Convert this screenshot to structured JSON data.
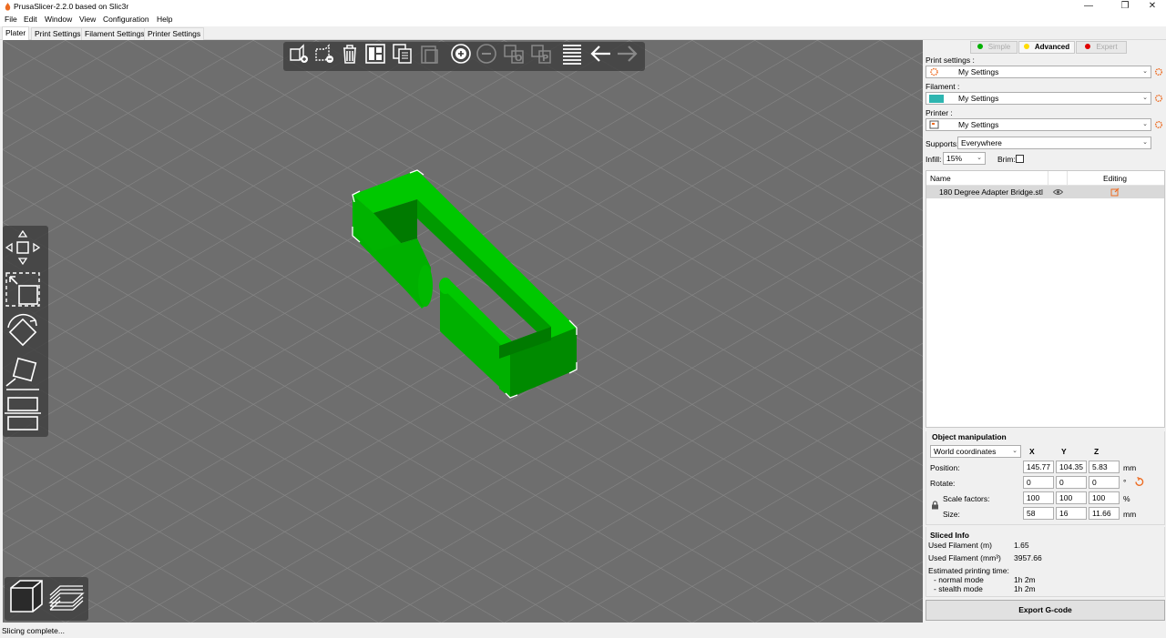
{
  "window": {
    "title": "PrusaSlicer-2.2.0 based on Slic3r",
    "minimize": "—",
    "restore": "❐",
    "close": "✕"
  },
  "menu": [
    "File",
    "Edit",
    "Window",
    "View",
    "Configuration",
    "Help"
  ],
  "tabs": [
    "Plater",
    "Print Settings",
    "Filament Settings",
    "Printer Settings"
  ],
  "top_toolbar_icons": [
    "add-icon",
    "delete-all-icon",
    "delete-icon",
    "arrange-icon",
    "copy-icon",
    "paste-icon",
    "add-instance-icon",
    "remove-instance-icon",
    "split-objects-icon",
    "split-parts-icon",
    "layers-editing-icon",
    "undo-icon",
    "redo-icon"
  ],
  "left_toolbar_icons": [
    "move-icon",
    "scale-icon",
    "rotate-icon",
    "place-on-face-icon",
    "cut-icon"
  ],
  "bottom_toolbar_icons": [
    "3d-view-icon",
    "preview-icon"
  ],
  "status": "Slicing complete...",
  "sidebar": {
    "modes": {
      "simple": "Simple",
      "advanced": "Advanced",
      "expert": "Expert"
    },
    "mode_colors": {
      "simple": "#00b000",
      "advanced": "#ffdc00",
      "expert": "#e00000"
    },
    "print_settings_label": "Print settings :",
    "print_settings_value": "My Settings",
    "filament_label": "Filament :",
    "filament_value": "My Settings",
    "filament_color": "#2eb5b0",
    "printer_label": "Printer :",
    "printer_value": "My Settings",
    "supports_label": "Supports:",
    "supports_value": "Everywhere",
    "infill_label": "Infill:",
    "infill_value": "15%",
    "brim_label": "Brim:",
    "brim_checked": false,
    "object_list": {
      "col_name": "Name",
      "col_editing": "Editing",
      "rows": [
        {
          "name": "180 Degree Adapter Bridge.stl"
        }
      ]
    },
    "object_manipulation": {
      "title": "Object manipulation",
      "coord_system": "World coordinates",
      "x_header": "X",
      "y_header": "Y",
      "z_header": "Z",
      "position_label": "Position:",
      "position": [
        "145.77",
        "104.35",
        "5.83"
      ],
      "position_unit": "mm",
      "rotate_label": "Rotate:",
      "rotate": [
        "0",
        "0",
        "0"
      ],
      "rotate_unit": "°",
      "scale_label": "Scale factors:",
      "scale": [
        "100",
        "100",
        "100"
      ],
      "scale_unit": "%",
      "size_label": "Size:",
      "size": [
        "58",
        "16",
        "11.66"
      ],
      "size_unit": "mm"
    },
    "sliced_info": {
      "title": "Sliced Info",
      "used_filament_m_label": "Used Filament (m)",
      "used_filament_m": "1.65",
      "used_filament_mm3_label": "Used Filament (mm³)",
      "used_filament_mm3": "3957.66",
      "est_time_label": "Estimated printing time:",
      "normal_mode_label": "- normal mode",
      "normal_mode": "1h 2m",
      "stealth_mode_label": "- stealth mode",
      "stealth_mode": "1h 2m"
    },
    "export_button": "Export G-code"
  }
}
